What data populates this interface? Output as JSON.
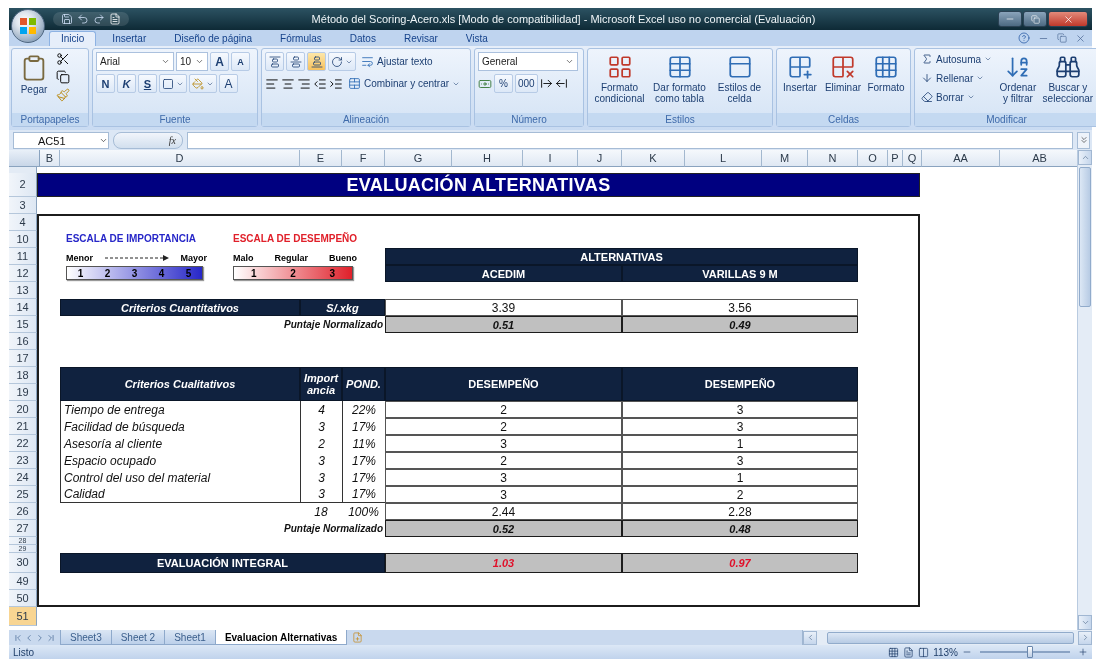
{
  "window": {
    "title": "Método del Scoring-Acero.xls  [Modo de compatibilidad] - Microsoft Excel uso no comercial (Evaluación)"
  },
  "ribbon_tabs": [
    {
      "label": "Inicio",
      "selected": true
    },
    {
      "label": "Insertar",
      "selected": false
    },
    {
      "label": "Diseño de página",
      "selected": false
    },
    {
      "label": "Fórmulas",
      "selected": false
    },
    {
      "label": "Datos",
      "selected": false
    },
    {
      "label": "Revisar",
      "selected": false
    },
    {
      "label": "Vista",
      "selected": false
    }
  ],
  "ribbon_groups": [
    {
      "kind": "clipboard",
      "label": "Portapapeles",
      "paste": "Pegar"
    },
    {
      "kind": "font",
      "label": "Fuente",
      "font": "Arial",
      "size": "10",
      "grow": "A",
      "shrink": "A",
      "bold": "N",
      "italic": "K",
      "underline": "S",
      "font_color": "A"
    },
    {
      "kind": "alignment",
      "label": "Alineación",
      "vertical_align": [
        {
          "selected": false
        },
        {
          "selected": false
        },
        {
          "selected": true
        }
      ],
      "wrap": "Ajustar texto",
      "merge": "Combinar y centrar"
    },
    {
      "kind": "number",
      "label": "Número",
      "format": "General",
      "percent": "%",
      "thousands": "000"
    },
    {
      "kind": "large",
      "label": "Estilos",
      "buttons": [
        "Formato condicional",
        "Dar formato como tabla",
        "Estilos de celda"
      ]
    },
    {
      "kind": "large",
      "label": "Celdas",
      "buttons": [
        "Insertar",
        "Eliminar",
        "Formato"
      ]
    },
    {
      "kind": "editing",
      "label": "Modificar",
      "small": [
        "Autosuma",
        "Rellenar",
        "Borrar"
      ],
      "large": [
        "Ordenar y filtrar",
        "Buscar y seleccionar"
      ]
    }
  ],
  "formula_bar": {
    "name_box": "AC51",
    "function_button": "fx"
  },
  "columns": [
    "B",
    "D",
    "E",
    "F",
    "G",
    "H",
    "I",
    "J",
    "K",
    "L",
    "M",
    "N",
    "O",
    "P",
    "Q",
    "AA",
    "AB"
  ],
  "rows": [
    {
      "label": "2",
      "selected": false
    },
    {
      "label": "3",
      "selected": false
    },
    {
      "label": "4",
      "selected": false
    },
    {
      "label": "10",
      "selected": false
    },
    {
      "label": "11",
      "selected": false
    },
    {
      "label": "12",
      "selected": false
    },
    {
      "label": "13",
      "selected": false
    },
    {
      "label": "14",
      "selected": false
    },
    {
      "label": "15",
      "selected": false
    },
    {
      "label": "16",
      "selected": false
    },
    {
      "label": "17",
      "selected": false
    },
    {
      "label": "18",
      "selected": false
    },
    {
      "label": "19",
      "selected": false
    },
    {
      "label": "20",
      "selected": false
    },
    {
      "label": "21",
      "selected": false
    },
    {
      "label": "22",
      "selected": false
    },
    {
      "label": "23",
      "selected": false
    },
    {
      "label": "24",
      "selected": false
    },
    {
      "label": "25",
      "selected": false
    },
    {
      "label": "26",
      "selected": false
    },
    {
      "label": "27",
      "selected": false
    },
    {
      "label": "28",
      "selected": false
    },
    {
      "label": "29",
      "selected": false
    },
    {
      "label": "30",
      "selected": false
    },
    {
      "label": "49",
      "selected": false
    },
    {
      "label": "50",
      "selected": false
    },
    {
      "label": "51",
      "selected": true
    }
  ],
  "sheet_title": "EVALUACIÓN ALTERNATIVAS",
  "scales": [
    {
      "kind": "arrow",
      "title": "ESCALA DE IMPORTANCIA",
      "color": "#2727c8",
      "labels": [
        "Menor",
        "Mayor"
      ],
      "values": [
        "1",
        "2",
        "3",
        "4",
        "5"
      ]
    },
    {
      "kind": "labels",
      "title": "ESCALA DE DESEMPEÑO",
      "color": "#e0202a",
      "labels": [
        "Malo",
        "Regular",
        "Bueno"
      ],
      "values": [
        "1",
        "2",
        "3"
      ]
    }
  ],
  "alternatives": {
    "header": "ALTERNATIVAS",
    "names": [
      "ACEDIM",
      "VARILLAS 9 M"
    ]
  },
  "quantitative": {
    "header": "Criterios Cuantitativos",
    "unit": "S/.xkg",
    "values": [
      "3.39",
      "3.56"
    ],
    "normalized_label": "Puntaje Normalizado",
    "normalized": [
      "0.51",
      "0.49"
    ]
  },
  "qualitative": {
    "headers": [
      "Criterios Cualitativos",
      "Import\nancia",
      "POND.",
      "DESEMPEÑO",
      "DESEMPEÑO"
    ],
    "rows": [
      {
        "criterion": "Tiempo de entrega",
        "importance": "4",
        "weight": "22%",
        "scores": [
          "2",
          "3"
        ]
      },
      {
        "criterion": "Facilidad de búsqueda",
        "importance": "3",
        "weight": "17%",
        "scores": [
          "2",
          "3"
        ]
      },
      {
        "criterion": "Asesoría al cliente",
        "importance": "2",
        "weight": "11%",
        "scores": [
          "3",
          "1"
        ]
      },
      {
        "criterion": "Espacio ocupado",
        "importance": "3",
        "weight": "17%",
        "scores": [
          "2",
          "3"
        ]
      },
      {
        "criterion": "Control del uso del material",
        "importance": "3",
        "weight": "17%",
        "scores": [
          "3",
          "1"
        ]
      },
      {
        "criterion": "Calidad",
        "importance": "3",
        "weight": "17%",
        "scores": [
          "3",
          "2"
        ]
      }
    ],
    "totals": {
      "importance": "18",
      "weight": "100%",
      "scores": [
        "2.44",
        "2.28"
      ]
    },
    "normalized_label": "Puntaje Normalizado",
    "normalized": [
      "0.52",
      "0.48"
    ]
  },
  "integral": {
    "label": "EVALUACIÓN INTEGRAL",
    "values": [
      "1.03",
      "0.97"
    ]
  },
  "sheet_tabs": [
    {
      "label": "Sheet3",
      "selected": false
    },
    {
      "label": "Sheet 2",
      "selected": false
    },
    {
      "label": "Sheet1",
      "selected": false
    },
    {
      "label": "Evaluacion Alternativas",
      "selected": true
    }
  ],
  "status_bar": {
    "text": "Listo",
    "zoom": {
      "reading": "113%",
      "level": 0.55
    }
  }
}
